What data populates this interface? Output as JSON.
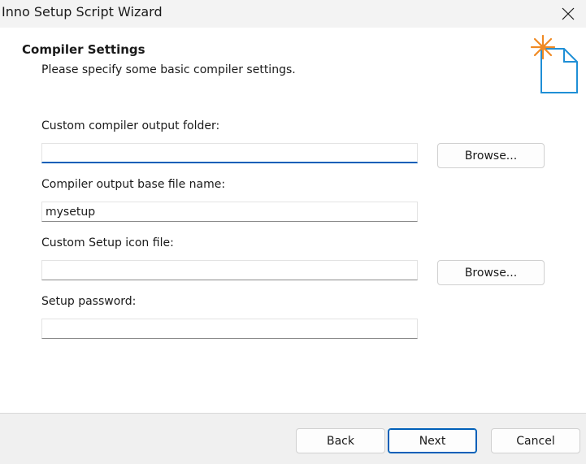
{
  "window": {
    "title": "Inno Setup Script Wizard"
  },
  "header": {
    "title": "Compiler Settings",
    "subtitle": "Please specify some basic compiler settings."
  },
  "form": {
    "output_folder": {
      "label": "Custom compiler output folder:",
      "value": "",
      "browse_label": "Browse..."
    },
    "base_file_name": {
      "label": "Compiler output base file name:",
      "value": "mysetup"
    },
    "setup_icon": {
      "label": "Custom Setup icon file:",
      "value": "",
      "browse_label": "Browse..."
    },
    "password": {
      "label": "Setup password:",
      "value": ""
    }
  },
  "footer": {
    "back_label": "Back",
    "next_label": "Next",
    "cancel_label": "Cancel"
  },
  "icons": {
    "close": "close-icon",
    "wizard": "new-document-sparkle-icon"
  },
  "colors": {
    "accent": "#005fb8",
    "sparkle": "#f08a24",
    "document_outline": "#1f8fd6"
  }
}
